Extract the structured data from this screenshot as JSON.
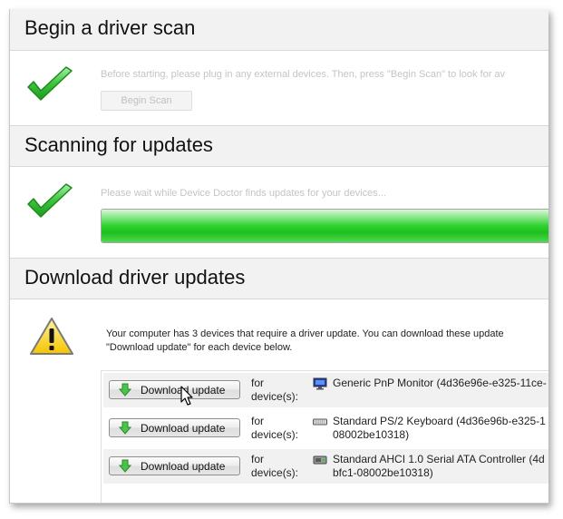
{
  "sections": {
    "begin_scan": {
      "title": "Begin a driver scan",
      "instructions": "Before starting, please plug in any external devices. Then, press \"Begin Scan\" to look for av",
      "button_label": "Begin Scan",
      "icon": "green-checkmark-icon"
    },
    "scanning": {
      "title": "Scanning for updates",
      "status_text": "Please wait while Device Doctor finds updates for your devices...",
      "progress_percent": 100,
      "progress_color": "#2ed12e",
      "icon": "green-checkmark-icon"
    },
    "download": {
      "title": "Download driver updates",
      "message_line1": "Your computer has 3 devices that require a driver update. You can download these update",
      "message_line2": "\"Download update\" for each device below.",
      "icon": "warning-triangle-icon",
      "devices": [
        {
          "button_label": "Download update",
          "for_label_line1": "for",
          "for_label_line2": "device(s):",
          "icon": "monitor-icon",
          "name_line1": "Generic PnP Monitor (4d36e96e-e325-11ce-",
          "name_line2": ""
        },
        {
          "button_label": "Download update",
          "for_label_line1": "for",
          "for_label_line2": "device(s):",
          "icon": "keyboard-icon",
          "name_line1": "Standard PS/2 Keyboard (4d36e96b-e325-1",
          "name_line2": "08002be10318)"
        },
        {
          "button_label": "Download update",
          "for_label_line1": "for",
          "for_label_line2": "device(s):",
          "icon": "storage-controller-icon",
          "name_line1": "Standard AHCI 1.0 Serial ATA Controller (4d",
          "name_line2": "bfc1-08002be10318)"
        }
      ]
    }
  },
  "colors": {
    "header_bg": "#f2f2f2",
    "check_green": "#3cc43c",
    "warning_yellow": "#f5c400"
  }
}
